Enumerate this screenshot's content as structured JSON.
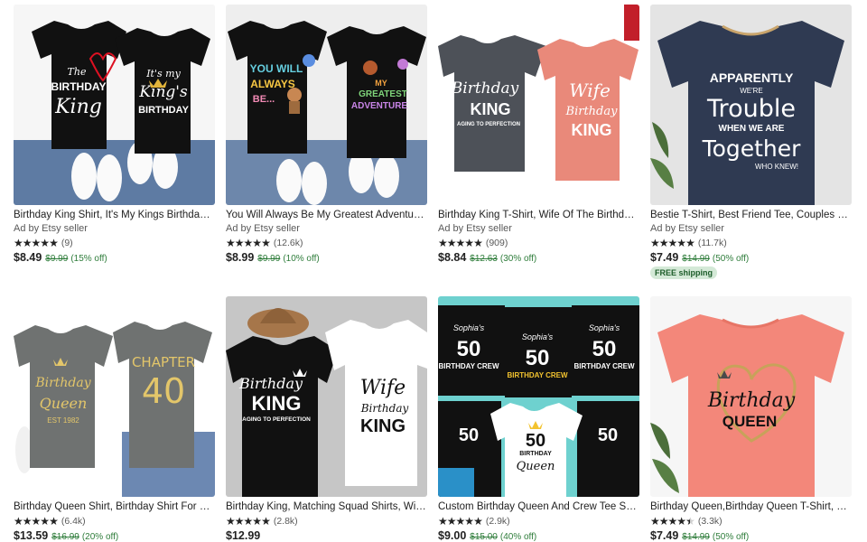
{
  "listings": [
    {
      "title": "Birthday King Shirt, It's My Kings Birthday Custo...",
      "ad": "Ad by Etsy seller",
      "reviews": "(9)",
      "price": "$8.49",
      "original": "$9.99",
      "discount": "(15% off)",
      "rating": 5,
      "image": {
        "bg": "#f4f4f4",
        "shirt1": "#111111",
        "shirt2": "#111111",
        "text1a": "The",
        "text1b": "BIRTHDAY",
        "text1c": "King",
        "text2a": "It's my",
        "text2b": "King's",
        "text2c": "BIRTHDAY"
      }
    },
    {
      "title": "You Will Always Be My Greatest Adventure Shirt, ...",
      "ad": "Ad by Etsy seller",
      "reviews": "(12.6k)",
      "price": "$8.99",
      "original": "$9.99",
      "discount": "(10% off)",
      "rating": 5,
      "image": {
        "bg": "#f2f2f2",
        "shirt1": "#111111",
        "shirt2": "#111111",
        "text1a": "YOU WILL",
        "text1b": "ALWAYS",
        "text1c": "BE...",
        "text2a": "MY",
        "text2b": "GREATEST",
        "text2c": "ADVENTURE"
      }
    },
    {
      "title": "Birthday King T-Shirt, Wife Of The Birthday King S...",
      "ad": "Ad by Etsy seller",
      "reviews": "(909)",
      "price": "$8.84",
      "original": "$12.63",
      "discount": "(30% off)",
      "rating": 5,
      "image": {
        "bg": "#ffffff",
        "shirt1": "#4d5158",
        "shirt2": "#e9897a",
        "text1a": "Birthday",
        "text1b": "KING",
        "text1c": "AGING TO PERFECTION",
        "text2a": "Wife",
        "text2b": "Birthday",
        "text2c": "KING"
      }
    },
    {
      "title": "Bestie T-Shirt, Best Friend Tee, Couples Matching...",
      "ad": "Ad by Etsy seller",
      "reviews": "(11.7k)",
      "price": "$7.49",
      "original": "$14.99",
      "discount": "(50% off)",
      "rating": 5,
      "badge": "FREE shipping",
      "image": {
        "bg": "#e6e6e6",
        "shirt1": "#2f3a52",
        "text1a": "APPARENTLY",
        "text1b": "Trouble",
        "text1c": "Together",
        "text2a": "WE'RE",
        "text2b": "WHEN WE ARE",
        "text2c": "WHO KNEW!"
      }
    },
    {
      "title": "Birthday Queen Shirt, Birthday Shirt For Women, ...",
      "reviews": "(6.4k)",
      "price": "$13.59",
      "original": "$16.99",
      "discount": "(20% off)",
      "rating": 5,
      "image": {
        "bg": "#ffffff",
        "shirt1": "#6f7271",
        "shirt2": "#6f7271",
        "text1a": "Birthday",
        "text1b": "Queen",
        "text1c": "EST 1982",
        "text2a": "CHAPTER",
        "text2b": "40"
      }
    },
    {
      "title": "Birthday King, Matching Squad Shirts, Wife of the...",
      "reviews": "(2.8k)",
      "price": "$12.99",
      "rating": 5,
      "image": {
        "bg": "#bdbdbd",
        "shirt1": "#111111",
        "shirt2": "#ffffff",
        "text1a": "Birthday",
        "text1b": "KING",
        "text1c": "AGING TO PERFECTION",
        "text2a": "Wife",
        "text2b": "Birthday",
        "text2c": "KING"
      }
    },
    {
      "title": "Custom Birthday Queen And Crew Tee Shirt, Pers...",
      "reviews": "(2.9k)",
      "price": "$9.00",
      "original": "$15.00",
      "discount": "(40% off)",
      "rating": 5,
      "image": {
        "bg": "#6ed1cf",
        "shirt1": "#111111",
        "shirt2": "#ffffff",
        "text1a": "Sophia's",
        "text1b": "50",
        "text1c": "BIRTHDAY CREW",
        "text2a": "50",
        "text2b": "BIRTHDAY",
        "text2c": "Queen"
      }
    },
    {
      "title": "Birthday Queen,Birthday Queen T-Shirt, Birthday ...",
      "reviews": "(3.3k)",
      "price": "$7.49",
      "original": "$14.99",
      "discount": "(50% off)",
      "rating": 4.5,
      "image": {
        "bg": "#f7f7f7",
        "shirt1": "#f3877a",
        "text1a": "Birthday",
        "text1b": "QUEEN"
      }
    }
  ],
  "icons": {
    "star": "star-icon",
    "half_star": "half-star-icon"
  },
  "colors": {
    "discount_green": "#2f7d3b",
    "badge_bg": "#d4e9d7"
  }
}
